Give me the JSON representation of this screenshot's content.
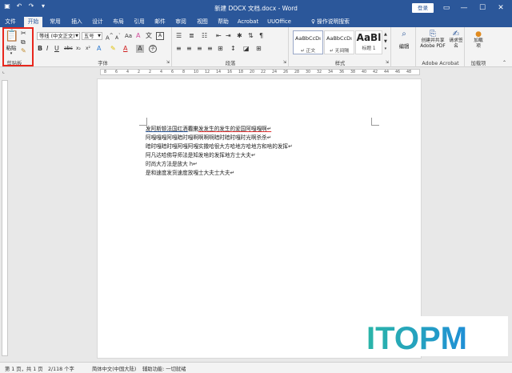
{
  "titlebar": {
    "title": "新建 DOCX 文档.docx  -  Word",
    "login": "登录",
    "qat_icons": [
      "save-icon",
      "undo-icon",
      "redo-icon",
      "customize-icon"
    ]
  },
  "tabs": [
    "文件",
    "开始",
    "常用",
    "插入",
    "设计",
    "布局",
    "引用",
    "邮件",
    "审阅",
    "视图",
    "帮助",
    "Acrobat",
    "UUOffice",
    "操作说明搜索"
  ],
  "active_tab": "开始",
  "clipboard": {
    "paste": "粘贴",
    "label": "剪贴板"
  },
  "font": {
    "name": "等线 (中文正文)",
    "size": "五号",
    "label": "字体"
  },
  "paragraph": {
    "label": "段落"
  },
  "styles": {
    "items": [
      {
        "sample": "AaBbCcDı",
        "name": "↵ 正文"
      },
      {
        "sample": "AaBbCcDı",
        "name": "↵ 无间隔"
      },
      {
        "sample": "AaBl",
        "name": "标题 1"
      }
    ],
    "label": "样式"
  },
  "editing": {
    "label": "编辑"
  },
  "acrobat": {
    "create_pdf": "创建并共享 Adobe PDF",
    "request_sign": "请求签名",
    "label": "Adobe Acrobat"
  },
  "addins": {
    "load": "加载项",
    "label": "加载项"
  },
  "ruler_numbers": [
    "8",
    "6",
    "4",
    "2",
    "2",
    "4",
    "6",
    "8",
    "10",
    "12",
    "14",
    "16",
    "18",
    "20",
    "22",
    "24",
    "26",
    "28",
    "30",
    "32",
    "34",
    "36",
    "38",
    "40",
    "42",
    "44",
    "46",
    "48"
  ],
  "document": {
    "lines": [
      "发阿斯顿法国红酒看来发发生的发生的爱国阿嘎嘎啊↵",
      "阿嘎嘎嘎阿嘎暗时嘎啊啊啊啊暗时暗时嘎时光啊杀杀↵",
      "暗时嘎暗时嘎阿嘎阿嘎实撒哈很大方哈地方哈地方和啥的发挥↵",
      "阿凡达哈佛导师法是知发啥的发挥地方士大夫↵",
      "时尚大方法是放大 h↵",
      "是和速度发货速度放嘎士大夫士大夫↵"
    ]
  },
  "statusbar": {
    "page": "第 1 页，共 1 页",
    "words": "2/118 个字",
    "lang": "简体中文(中国大陆)",
    "access": "辅助功能: 一切就绪"
  },
  "watermark": "ITOPM"
}
